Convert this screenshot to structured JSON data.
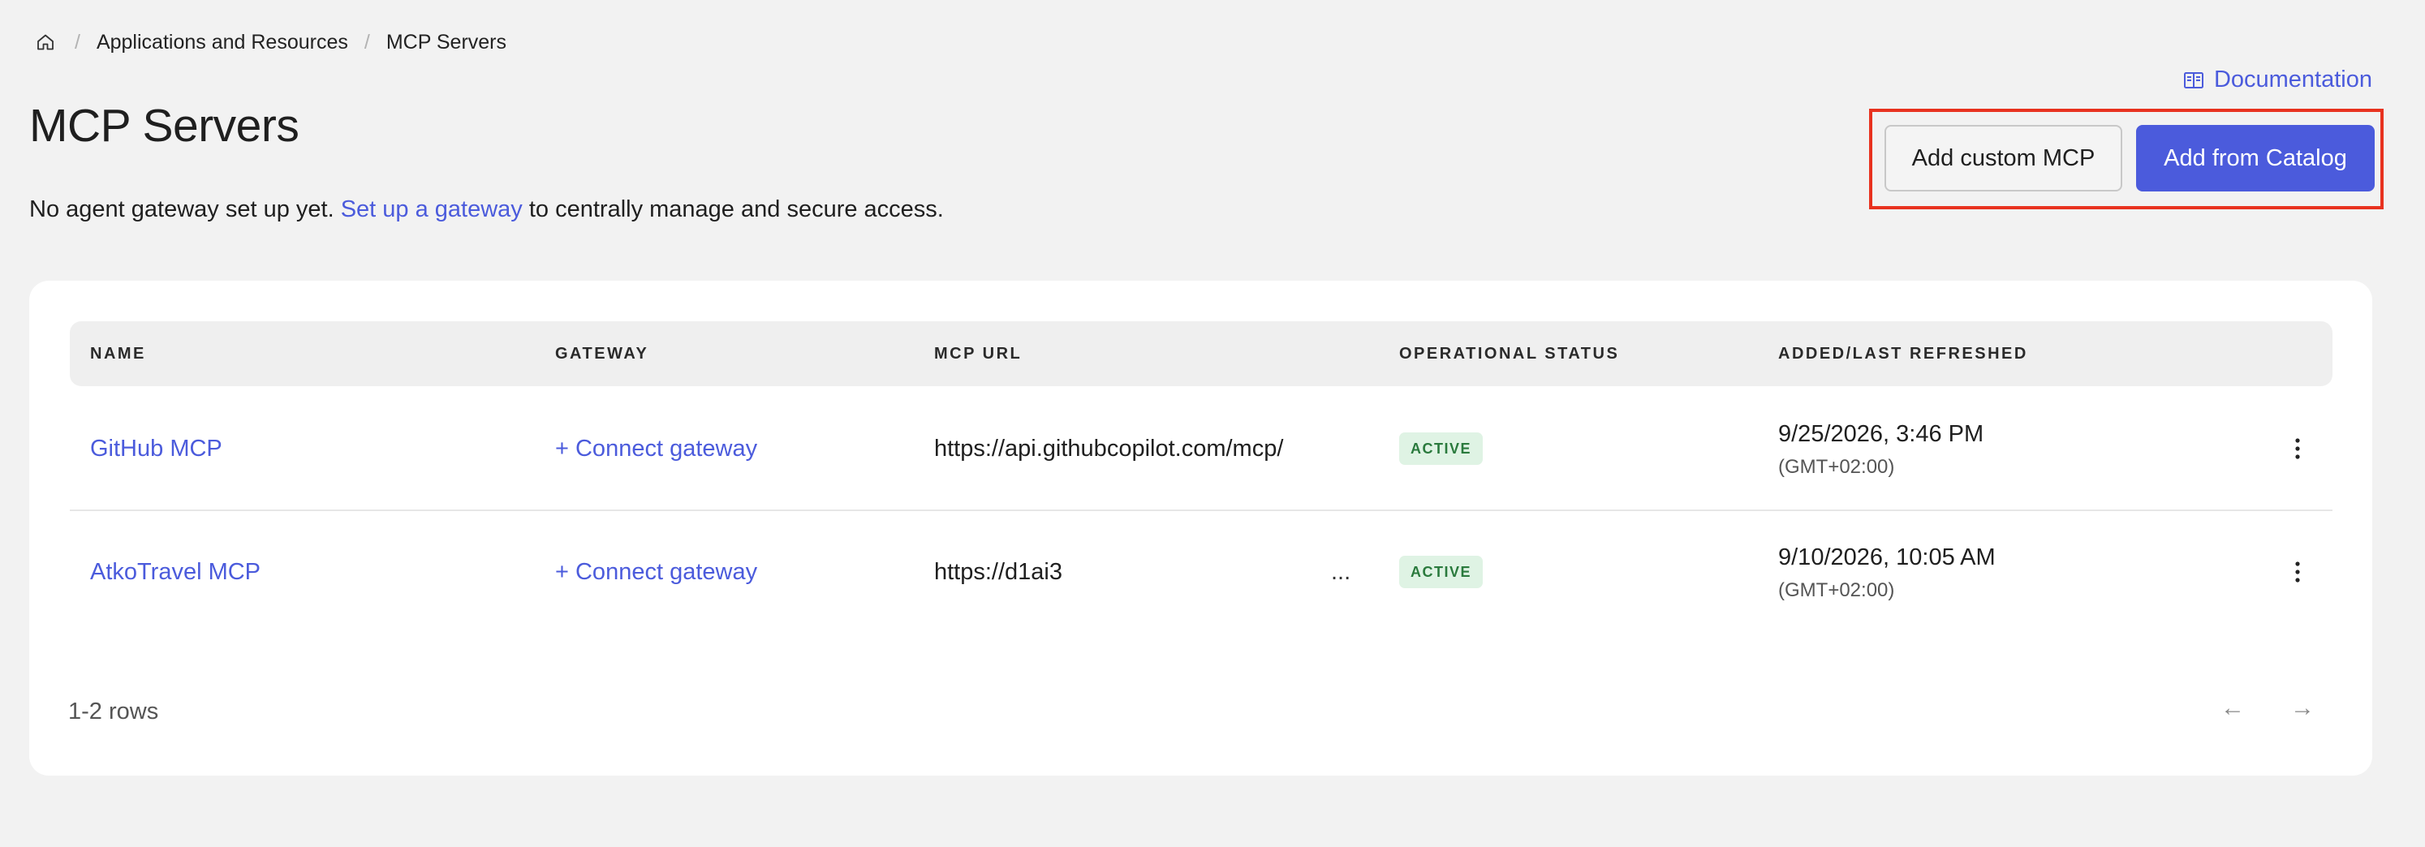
{
  "breadcrumb": {
    "home_icon": "home-icon",
    "separator": "/",
    "items": [
      "Applications and Resources",
      "MCP Servers"
    ]
  },
  "header": {
    "title": "MCP Servers",
    "documentation_label": "Documentation",
    "documentation_icon": "book-icon"
  },
  "notice": {
    "prefix": "No agent gateway set up yet. ",
    "link": "Set up a gateway",
    "suffix": " to centrally manage and secure access."
  },
  "actions": {
    "add_custom_label": "Add custom MCP",
    "add_catalog_label": "Add from Catalog",
    "highlight_color": "#e8321f",
    "primary_color": "#4b5bdc"
  },
  "table": {
    "columns": [
      "NAME",
      "GATEWAY",
      "MCP URL",
      "OPERATIONAL STATUS",
      "ADDED/LAST REFRESHED"
    ],
    "rows": [
      {
        "name": "GitHub MCP",
        "gateway": "+ Connect gateway",
        "url": "https://api.githubcopilot.com/mcp/",
        "status": "ACTIVE",
        "date": "9/25/2026, 3:46 PM",
        "timezone": "(GMT+02:00)"
      },
      {
        "name": "AtkoTravel MCP",
        "gateway": "+ Connect gateway",
        "url": "https://d1ai3",
        "url_more": "...",
        "status": "ACTIVE",
        "date": "9/10/2026, 10:05 AM",
        "timezone": "(GMT+02:00)"
      }
    ]
  },
  "footer": {
    "row_count": "1-2 rows",
    "prev": "←",
    "next": "→"
  }
}
